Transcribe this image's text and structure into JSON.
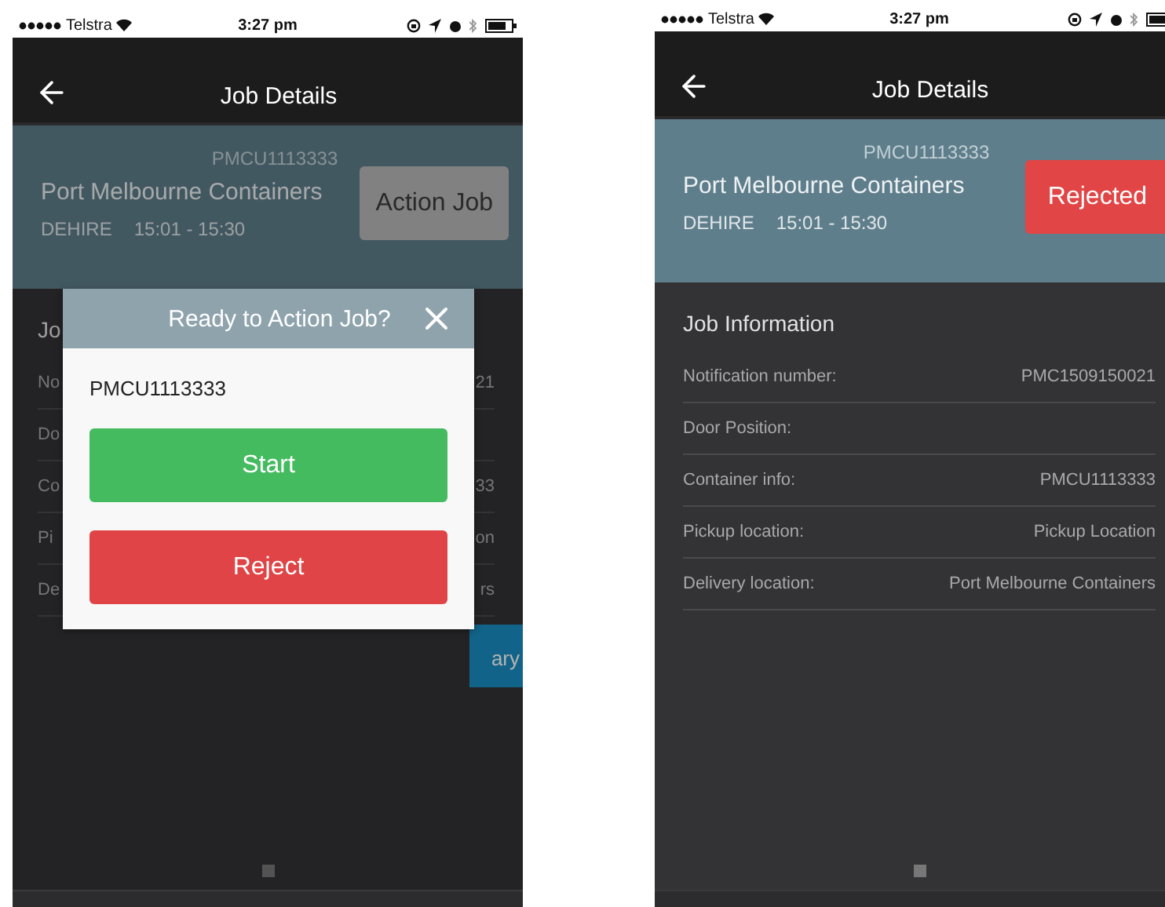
{
  "screens": [
    {
      "status_bar": {
        "carrier": "Telstra",
        "time": "3:27 pm"
      },
      "header": {
        "title": "Job Details"
      },
      "job": {
        "container": "PMCU1113333",
        "name": "Port Melbourne Containers",
        "type": "DEHIRE",
        "time_window": "15:01 - 15:30",
        "action": {
          "label": "Action Job",
          "kind": "pending"
        }
      },
      "details": {
        "heading": "Jo",
        "rows": [
          {
            "label": "No",
            "value": "21"
          },
          {
            "label": "Do",
            "value": ""
          },
          {
            "label": "Co",
            "value": "33"
          },
          {
            "label": "Pi",
            "value": "on"
          },
          {
            "label": "De",
            "value": "rs"
          }
        ]
      },
      "footer_button": {
        "label": "ary"
      },
      "dialog": {
        "title": "Ready to Action Job?",
        "container": "PMCU1113333",
        "buttons": [
          {
            "label": "Start",
            "kind": "start"
          },
          {
            "label": "Reject",
            "kind": "reject"
          }
        ]
      }
    },
    {
      "status_bar": {
        "carrier": "Telstra",
        "time": "3:27 pm"
      },
      "header": {
        "title": "Job Details"
      },
      "job": {
        "container": "PMCU1113333",
        "name": "Port Melbourne Containers",
        "type": "DEHIRE",
        "time_window": "15:01 - 15:30",
        "action": {
          "label": "Rejected",
          "kind": "rejected"
        }
      },
      "details": {
        "heading": "Job Information",
        "rows": [
          {
            "label": "Notification number:",
            "value": "PMC1509150021"
          },
          {
            "label": "Door Position:",
            "value": ""
          },
          {
            "label": "Container info:",
            "value": "PMCU1113333"
          },
          {
            "label": "Pickup location:",
            "value": "Pickup Location"
          },
          {
            "label": "Delivery location:",
            "value": "Port Melbourne Containers"
          }
        ]
      }
    }
  ]
}
